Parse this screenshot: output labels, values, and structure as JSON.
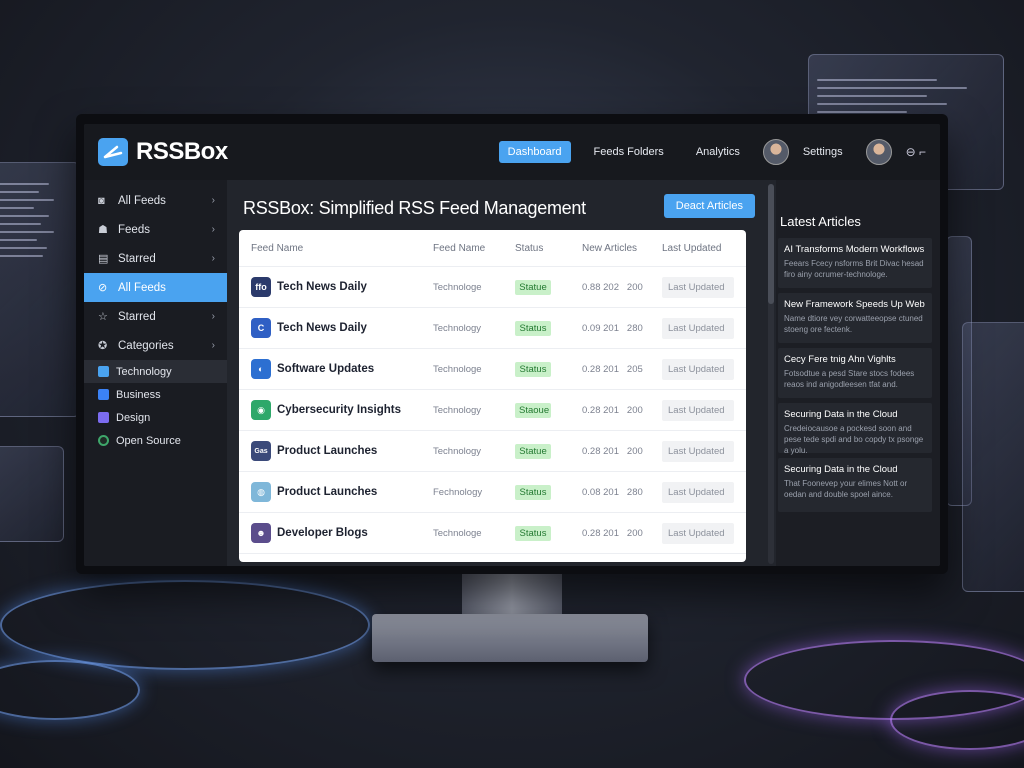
{
  "app": {
    "name": "RSSBox",
    "accent": "#4aa3f0",
    "status_color": "#c9f0c9"
  },
  "topnav": {
    "items": [
      {
        "label": "Dashboard",
        "active": true
      },
      {
        "label": "Feeds Folders",
        "active": false
      },
      {
        "label": "Analytics",
        "active": false
      },
      {
        "label": "Settings",
        "active": false
      }
    ],
    "power_icon": "⊖ ⌐"
  },
  "sidebar": {
    "items": [
      {
        "label": "All Feeds",
        "icon": "camera-icon",
        "glyph": "◙",
        "chevron": "›"
      },
      {
        "label": "Feeds",
        "icon": "users-icon",
        "glyph": "☗",
        "chevron": "›"
      },
      {
        "label": "Starred",
        "icon": "list-icon",
        "glyph": "▤",
        "chevron": "›"
      },
      {
        "label": "All Feeds",
        "icon": "rss-icon",
        "glyph": "⊘",
        "chevron": "",
        "active": true
      },
      {
        "label": "Starred",
        "icon": "star-icon",
        "glyph": "☆",
        "chevron": "›"
      },
      {
        "label": "Categories",
        "icon": "tag-icon",
        "glyph": "✪",
        "chevron": "›"
      }
    ],
    "categories": [
      {
        "label": "Technology",
        "icon": "technology-icon",
        "color": "#4aa3f0"
      },
      {
        "label": "Business",
        "icon": "business-icon",
        "color": "#3b82f6"
      },
      {
        "label": "Design",
        "icon": "design-icon",
        "color": "#7c6cf0"
      },
      {
        "label": "Open Source",
        "icon": "open-source-icon",
        "color": "#1f2b26"
      }
    ]
  },
  "main": {
    "title": "RSSBox: Simplified RSS Feed Management",
    "action_button": "Deact Articles",
    "columns": [
      "Feed Name",
      "Feed Name",
      "Status",
      "New Articles",
      "Last Updated"
    ],
    "rows": [
      {
        "name": "Tech News Daily",
        "category": "Technologe",
        "status": "Statue",
        "articles": "0.88 202",
        "count": "200",
        "updated": "Last Updated",
        "icon": "tech-news-icon",
        "glyph": "ffo",
        "color": "#2b3a6b"
      },
      {
        "name": "Tech News Daily",
        "category": "Technology",
        "status": "Status",
        "articles": "0.09 201",
        "count": "280",
        "updated": "Last Updated",
        "icon": "c-logo-icon",
        "glyph": "C",
        "color": "#2f5fc4"
      },
      {
        "name": "Software Updates",
        "category": "Technologe",
        "status": "Status",
        "articles": "0.28 201",
        "count": "205",
        "updated": "Last Updated",
        "icon": "shield-icon",
        "glyph": "◐",
        "color": "#2c6fd1"
      },
      {
        "name": "Cybersecurity Insights",
        "category": "Technology",
        "status": "Staoue",
        "articles": "0.28 201",
        "count": "200",
        "updated": "Last Updated",
        "icon": "security-icon",
        "glyph": "◉",
        "color": "#2ea86a"
      },
      {
        "name": "Product Launches",
        "category": "Technology",
        "status": "Statue",
        "articles": "0.28 201",
        "count": "200",
        "updated": "Last Updated",
        "icon": "gem-icon",
        "glyph": "Gas",
        "color": "#3b4a7a"
      },
      {
        "name": "Product Launches",
        "category": "Fechnology",
        "status": "Status",
        "articles": "0.08 201",
        "count": "280",
        "updated": "Last Updated",
        "icon": "globe-icon",
        "glyph": "◍",
        "color": "#7fb7d9"
      },
      {
        "name": "Developer Blogs",
        "category": "Technologe",
        "status": "Status",
        "articles": "0.28 201",
        "count": "200",
        "updated": "Last Updated",
        "icon": "developer-icon",
        "glyph": "☻",
        "color": "#5b4d8c"
      }
    ]
  },
  "latest": {
    "title": "Latest Articles",
    "articles": [
      {
        "title": "AI Transforms Modern Workflows",
        "desc": "Feears Fcecy nsforms Brit Divac hesad firo ainy ocrumer-technologe."
      },
      {
        "title": "New Framework Speeds Up Web A",
        "desc": "Name dtiore vey corwatteeopse ctuned stoeng ore fectenk."
      },
      {
        "title": "Cecy Fere tnig Ahn Vighlts",
        "desc": "Fotsodtue a pesd Stare stocs fodees reaos ind anigodleesen tfat and."
      },
      {
        "title": "Securing Data in the Cloud",
        "desc": "Credeiocausoe a pockesd soon and pese tede spdi and bo copdy tx psonge a yolu."
      },
      {
        "title": "Securing Data in the Cloud",
        "desc": "That Foonevep your elimes Nott or oedan and double spoel aince."
      }
    ]
  }
}
